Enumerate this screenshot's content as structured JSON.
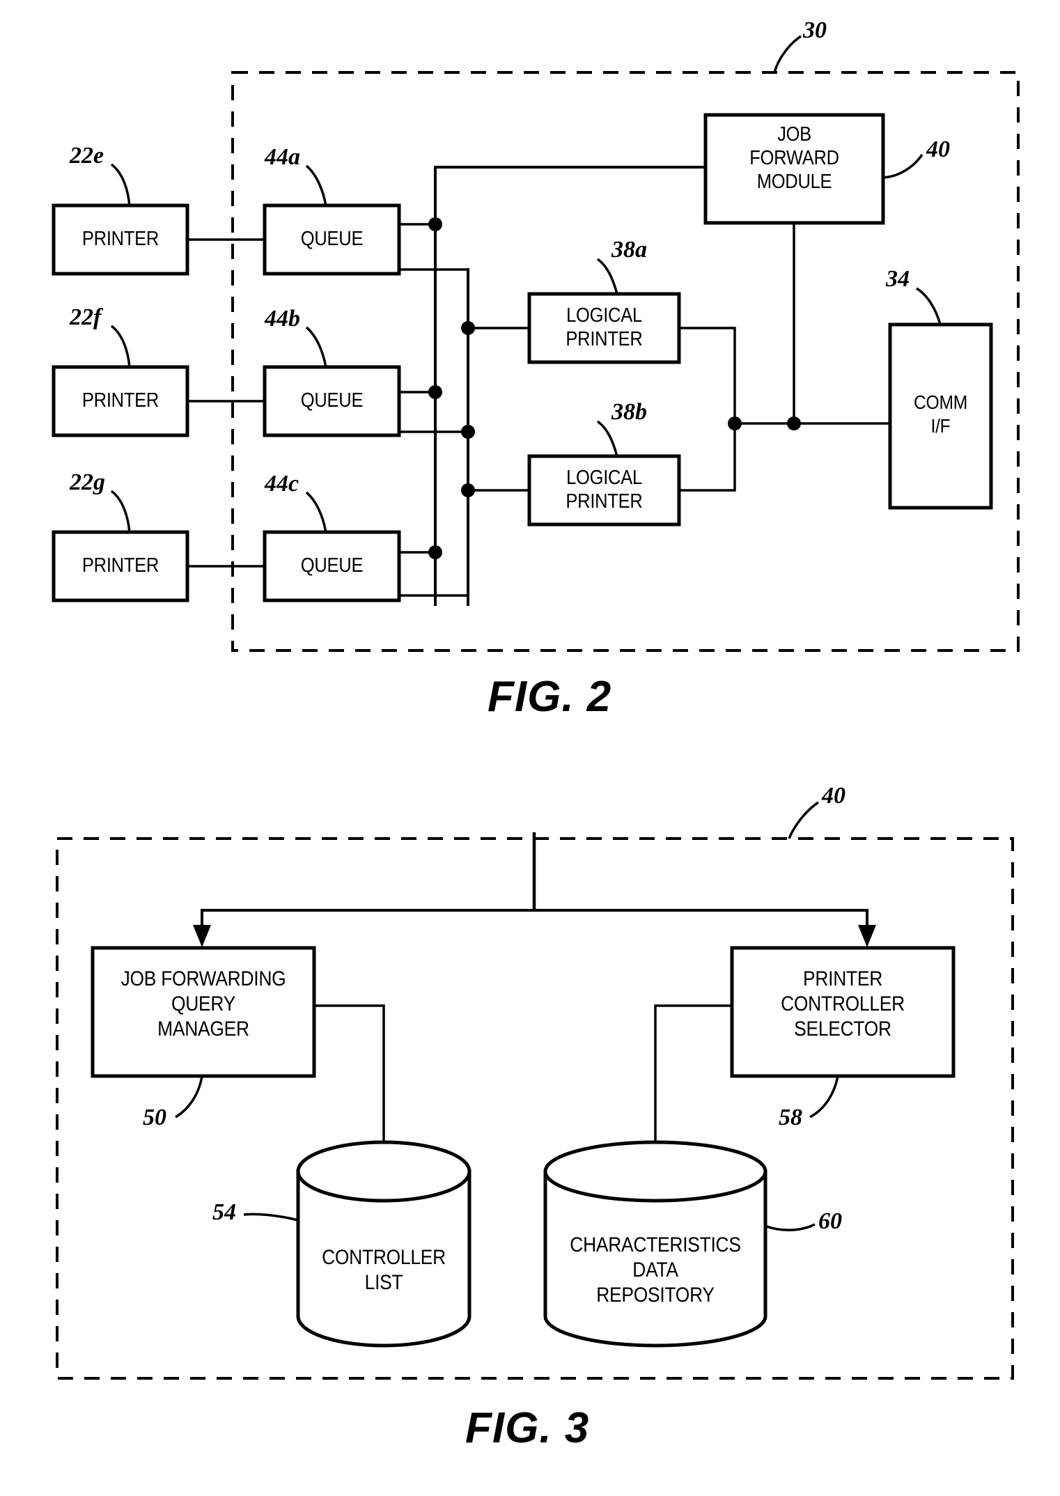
{
  "figures": [
    {
      "id": "fig2",
      "caption": "FIG. 2",
      "system_ref": "30",
      "blocks": [
        {
          "key": "printer_22e",
          "label": "PRINTER",
          "ref": "22e"
        },
        {
          "key": "printer_22f",
          "label": "PRINTER",
          "ref": "22f"
        },
        {
          "key": "printer_22g",
          "label": "PRINTER",
          "ref": "22g"
        },
        {
          "key": "queue_44a",
          "label": "QUEUE",
          "ref": "44a"
        },
        {
          "key": "queue_44b",
          "label": "QUEUE",
          "ref": "44b"
        },
        {
          "key": "queue_44c",
          "label": "QUEUE",
          "ref": "44c"
        },
        {
          "key": "logical_printer_38a",
          "label_line1": "LOGICAL",
          "label_line2": "PRINTER",
          "ref": "38a"
        },
        {
          "key": "logical_printer_38b",
          "label_line1": "LOGICAL",
          "label_line2": "PRINTER",
          "ref": "38b"
        },
        {
          "key": "job_forward_module_40",
          "label_line1": "JOB",
          "label_line2": "FORWARD",
          "label_line3": "MODULE",
          "ref": "40"
        },
        {
          "key": "comm_if_34",
          "label_line1": "COMM",
          "label_line2": "I/F",
          "ref": "34"
        }
      ]
    },
    {
      "id": "fig3",
      "caption": "FIG. 3",
      "system_ref": "40",
      "blocks": [
        {
          "key": "job_forwarding_query_manager_50",
          "label_line1": "JOB FORWARDING",
          "label_line2": "QUERY",
          "label_line3": "MANAGER",
          "ref": "50"
        },
        {
          "key": "printer_controller_selector_58",
          "label_line1": "PRINTER",
          "label_line2": "CONTROLLER",
          "label_line3": "SELECTOR",
          "ref": "58"
        },
        {
          "key": "controller_list_54",
          "label_line1": "CONTROLLER",
          "label_line2": "LIST",
          "ref": "54"
        },
        {
          "key": "characteristics_data_repository_60",
          "label_line1": "CHARACTERISTICS",
          "label_line2": "DATA",
          "label_line3": "REPOSITORY",
          "ref": "60"
        }
      ]
    }
  ],
  "colors": {
    "ink": "#000000",
    "paper": "#ffffff"
  }
}
